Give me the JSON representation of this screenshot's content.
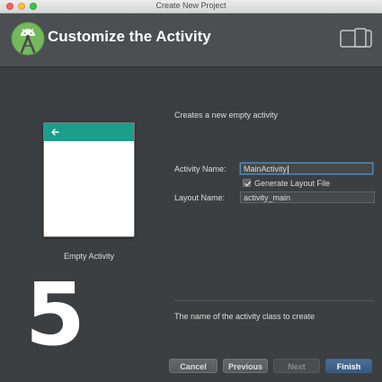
{
  "window": {
    "title": "Create New Project"
  },
  "header": {
    "title": "Customize the Activity",
    "logo_icon": "android-studio-logo-icon",
    "device_icon": "devices-icon"
  },
  "preview": {
    "label": "Empty Activity",
    "toolbar_color": "#1b9e8a",
    "back_icon": "back-arrow-icon"
  },
  "overlay": {
    "number": "5"
  },
  "form": {
    "description": "Creates a new empty activity",
    "activity_name_label": "Activity Name:",
    "activity_name_value": "MainActivity",
    "generate_layout_label": "Generate Layout File",
    "generate_layout_checked": true,
    "layout_name_label": "Layout Name:",
    "layout_name_value": "activity_main"
  },
  "hint": "The name of the activity class to create",
  "buttons": {
    "cancel": "Cancel",
    "previous": "Previous",
    "next": "Next",
    "finish": "Finish"
  }
}
